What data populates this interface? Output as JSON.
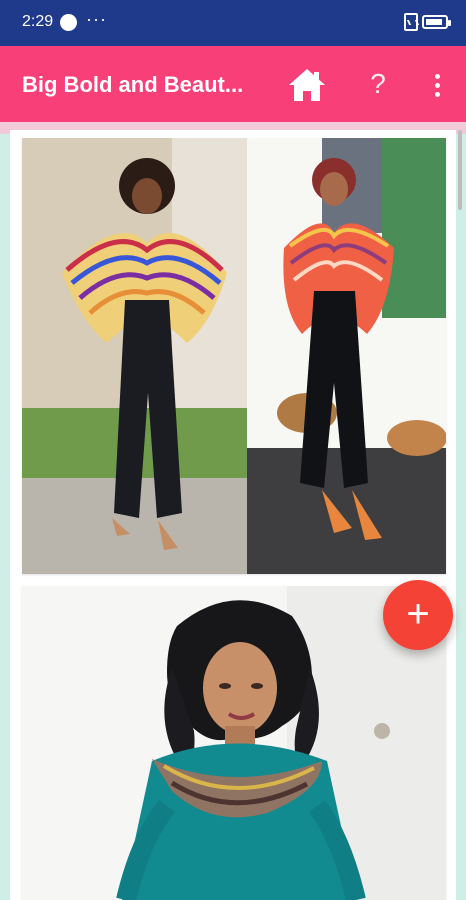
{
  "status": {
    "time": "2:29",
    "more": "···"
  },
  "app_bar": {
    "title": "Big Bold and Beaut..."
  },
  "icons": {
    "home": "home-icon",
    "help": "question-icon",
    "menu": "more-vertical-icon",
    "fab": "plus-icon"
  },
  "colors": {
    "status_bar": "#1f3a8a",
    "app_bar": "#f83f78",
    "fab": "#f44336"
  },
  "feed": {
    "cards": [
      {
        "type": "image",
        "subject": "two women in striped cropped tops and black jeans"
      },
      {
        "type": "image",
        "subject": "woman in teal dress with ruffled neckline"
      }
    ]
  },
  "fab": {
    "label": "+"
  }
}
